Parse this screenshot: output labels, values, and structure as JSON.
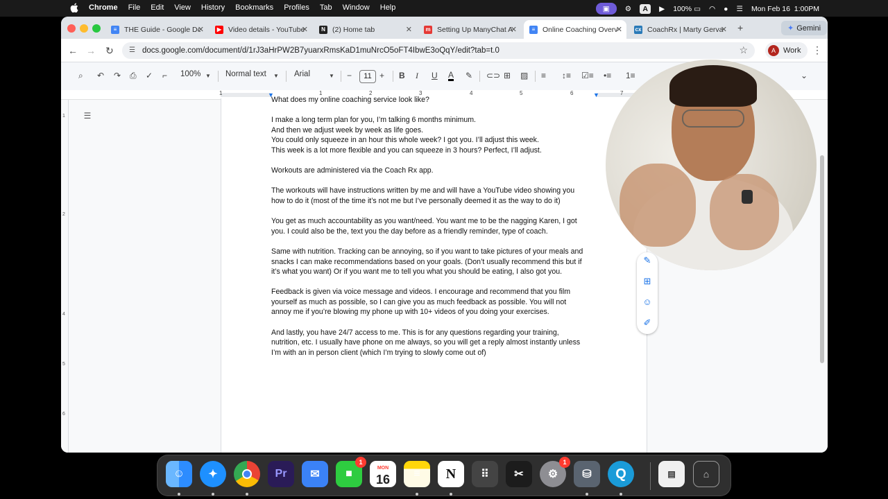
{
  "menubar": {
    "app": "Chrome",
    "items": [
      "File",
      "Edit",
      "View",
      "History",
      "Bookmarks",
      "Profiles",
      "Tab",
      "Window",
      "Help"
    ],
    "battery": "100%",
    "datetime": "Mon Feb 16  1:00PM",
    "input_source": "A"
  },
  "tabs": [
    {
      "title": "THE Guide - Google Do",
      "favicon": "docs-icon",
      "color": "#4285f4"
    },
    {
      "title": "Video details - YouTube",
      "favicon": "youtube-icon",
      "color": "#ff0000"
    },
    {
      "title": "(2) Home tab",
      "favicon": "notion-icon",
      "color": "#222222"
    },
    {
      "title": "Setting Up ManyChat A",
      "favicon": "manychat-icon",
      "color": "#e53935"
    },
    {
      "title": "Online Coaching Overv",
      "favicon": "docs-icon",
      "color": "#4285f4"
    },
    {
      "title": "CoachRx | Marty Gerva",
      "favicon": "coachrx-icon",
      "color": "#2a7ab8"
    }
  ],
  "gemini_label": "Gemini",
  "address": "docs.google.com/document/d/1rJ3aHrPW2B7yuarxRmsKaD1muNrcO5oFT4IbwE3oQqY/edit?tab=t.0",
  "profile": {
    "initial": "A",
    "label": "Work"
  },
  "toolbar": {
    "zoom": "100%",
    "style": "Normal text",
    "font": "Arial",
    "font_size": "11"
  },
  "ruler_numbers": [
    "1",
    "1",
    "2",
    "3",
    "4",
    "5",
    "6",
    "7"
  ],
  "document": {
    "heading": "What does my online coaching service look like?",
    "paragraphs": [
      [
        "I make a long term plan for you, I’m talking 6 months minimum.",
        "And then we adjust week by week as life goes.",
        "You could only squeeze in an hour this whole week? I got you. I’ll adjust this week.",
        "This week is a lot more flexible and you can squeeze in 3 hours? Perfect, I’ll adjust."
      ],
      [
        "Workouts are administered via the Coach Rx app."
      ],
      [
        "The workouts will have instructions written by me and will have a YouTube video showing you",
        "how to do it (most of the time it’s not me but I’ve personally deemed it as the way to do it)"
      ],
      [
        "You get as much accountability as you want/need. You want me to be the nagging Karen, I got",
        "you. I could also be the, text you the day before as a friendly reminder, type of coach."
      ],
      [
        "Same with nutrition. Tracking can be annoying, so if you want to take pictures of your meals and",
        "snacks I can make recommendations based on your goals. (Don’t usually recommend this but if",
        "it’s what you want) Or if you want me to tell you what you should be eating, I also got you."
      ],
      [
        "Feedback is given via voice message and videos. I encourage and recommend that you film",
        "yourself as much as possible, so I can give you as much feedback as possible. You will not",
        "annoy me if you’re blowing my phone up with 10+ videos of you doing your exercises."
      ],
      [
        "And lastly, you have 24/7 access to me. This is for any questions regarding your training,",
        "nutrition, etc. I usually have phone on me always, so you will get a reply almost instantly unless",
        "I’m with an in person client (which I’m trying to slowly come out of)"
      ]
    ]
  },
  "dock": [
    {
      "name": "finder-icon",
      "label": "",
      "color": "#2d8cff",
      "running": true
    },
    {
      "name": "safari-icon",
      "label": "",
      "color": "#1e90ff",
      "running": true
    },
    {
      "name": "chrome-icon",
      "label": "",
      "color": "#ffffff",
      "running": true
    },
    {
      "name": "premiere-icon",
      "label": "Pr",
      "color": "#2a1b57",
      "running": false
    },
    {
      "name": "mail-icon",
      "label": "",
      "color": "#3b82f6",
      "running": false
    },
    {
      "name": "facetime-icon",
      "label": "",
      "color": "#2ecc40",
      "running": false,
      "badge": "1"
    },
    {
      "name": "calendar-icon",
      "label": "16",
      "sublabel": "MON",
      "color": "#ffffff",
      "running": false
    },
    {
      "name": "notes-icon",
      "label": "",
      "color": "#ffd60a",
      "running": true
    },
    {
      "name": "notion-app-icon",
      "label": "N",
      "color": "#ffffff",
      "running": true
    },
    {
      "name": "launchpad-icon",
      "label": "",
      "color": "#444444",
      "running": false
    },
    {
      "name": "capcut-icon",
      "label": "",
      "color": "#1c1c1c",
      "running": false
    },
    {
      "name": "settings-icon",
      "label": "",
      "color": "#8e8e93",
      "running": false,
      "badge": "1"
    },
    {
      "name": "disk-utility-icon",
      "label": "",
      "color": "#5a6470",
      "running": true
    },
    {
      "name": "quicktime-icon",
      "label": "Q",
      "color": "#1a9bd8",
      "running": true
    }
  ]
}
